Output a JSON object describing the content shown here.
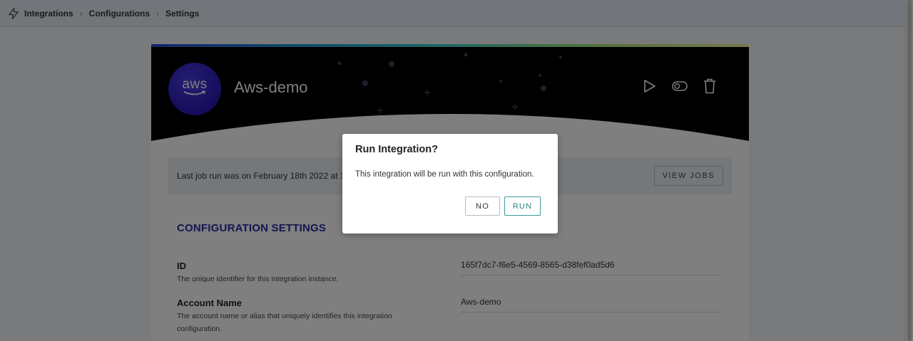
{
  "breadcrumb": {
    "items": [
      "Integrations",
      "Configurations",
      "Settings"
    ],
    "separator": ">"
  },
  "integration": {
    "logo_text": "aws",
    "name": "Aws-demo",
    "actions": [
      "play-icon",
      "toggle-icon",
      "trash-icon"
    ]
  },
  "job_bar": {
    "text": "Last job run was on February 18th 2022 at 1",
    "view_jobs_label": "VIEW JOBS"
  },
  "settings": {
    "title": "CONFIGURATION SETTINGS",
    "fields": [
      {
        "label": "ID",
        "description": "The unique identifier for this integration instance.",
        "value": "165f7dc7-f6e5-4569-8565-d38fef0ad5d6"
      },
      {
        "label": "Account Name",
        "description": "The account name or alias that uniquely identifies this integration configuration.",
        "value": "Aws-demo"
      }
    ]
  },
  "modal": {
    "title": "Run Integration?",
    "body": "This integration will be run with this configuration.",
    "no_label": "NO",
    "run_label": "RUN"
  },
  "colors": {
    "accent": "#2b2aa6",
    "run_button": "#2d8585",
    "logo_bg": "#2a1ab5",
    "hero_bg": "#000000"
  }
}
